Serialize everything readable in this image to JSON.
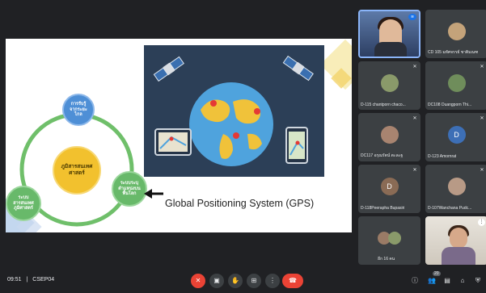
{
  "slide": {
    "cycle": {
      "center": "ภูมิสารสนเทศศาสตร์",
      "top": "การรับรู้จากระยะไกล",
      "left": "ระบบสารสนเทศภูมิศาสตร์",
      "right": "ระบบระบุตำแหน่งบนพื้นโลก"
    },
    "gps_caption": "Global Positioning System (GPS)"
  },
  "participants": [
    {
      "name": "",
      "type": "speaker"
    },
    {
      "name": "CD 105 มหัศจรรย์ ชาติมณฑ",
      "type": "photo"
    },
    {
      "name": "D-115 chantporn chaco...",
      "type": "photo"
    },
    {
      "name": "DC108 Duangporn Thi...",
      "type": "photo"
    },
    {
      "name": "DC117 อรุณรัตน์ ตะละฐ",
      "type": "photo"
    },
    {
      "name": "D-123 Amornrat",
      "type": "initial",
      "initial": "D"
    },
    {
      "name": "D-118Peerapha Bupasiri",
      "type": "initial",
      "initial": "D"
    },
    {
      "name": "D-107Wanchana Pudc...",
      "type": "photo"
    },
    {
      "name": "อีก 16 คน",
      "type": "group"
    },
    {
      "name": "",
      "type": "camera"
    }
  ],
  "bottombar": {
    "time": "09:51",
    "separator": "|",
    "meeting_code": "CSEP04",
    "participants_count": "20"
  },
  "colors": {
    "accent": "#ea4335",
    "background": "#202124",
    "tile": "#3c4043"
  }
}
